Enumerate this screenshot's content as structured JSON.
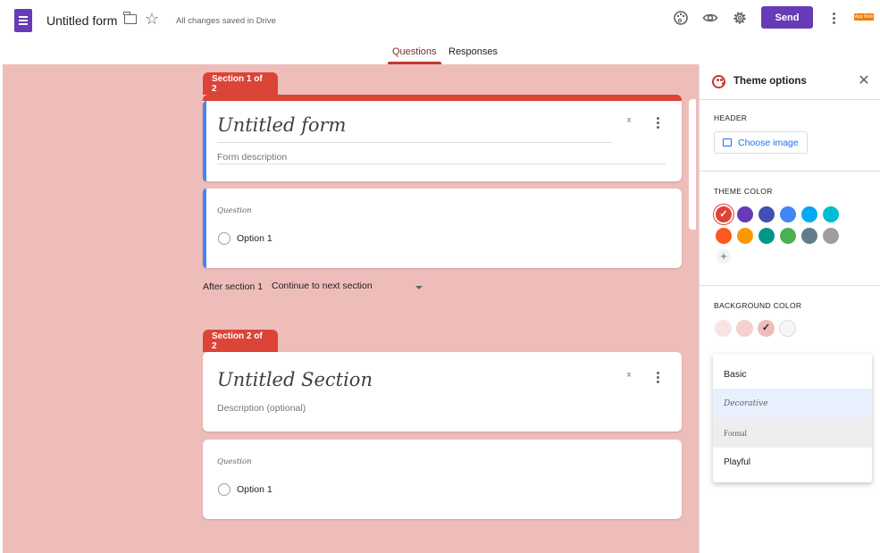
{
  "topbar": {
    "doc_title": "Untitled form",
    "save_status": "All changes saved in Drive",
    "send_label": "Send",
    "apps_badge": "App Web",
    "icons": [
      "forms-logo-icon",
      "folder-icon",
      "star-icon",
      "palette-icon",
      "eye-icon",
      "gear-icon",
      "more-vert-icon"
    ]
  },
  "tabs": [
    {
      "label": "Questions",
      "active": true
    },
    {
      "label": "Responses",
      "active": false
    }
  ],
  "sections": [
    {
      "tab_label": "Section 1 of 2",
      "title": "Untitled form",
      "description": "Form description",
      "question": {
        "label": "Question",
        "option": "Option 1"
      }
    },
    {
      "tab_label": "Section 2 of 2",
      "title": "Untitled Section",
      "description": "Description (optional)",
      "question": {
        "label": "Question",
        "option": "Option 1"
      }
    }
  ],
  "after_section": {
    "label": "After section 1",
    "value": "Continue to next section"
  },
  "theme_panel": {
    "title": "Theme options",
    "header_heading": "HEADER",
    "choose_image_label": "Choose image",
    "theme_color_heading": "THEME COLOR",
    "theme_colors": [
      "#db4437",
      "#673ab7",
      "#3f51b5",
      "#4285f4",
      "#03a9f4",
      "#00bcd4",
      "#ff5722",
      "#ff9800",
      "#009688",
      "#4caf50",
      "#607d8b",
      "#9e9e9e"
    ],
    "theme_color_selected": "#db4437",
    "background_color_heading": "BACKGROUND COLOR",
    "background_colors": [
      "#fae3e3",
      "#f6cfcf",
      "#efbdb9",
      "#f6f6f6"
    ],
    "background_color_selected": "#efbdb9",
    "font_options": [
      "Basic",
      "Decorative",
      "Formal",
      "Playful"
    ],
    "font_hovered": "Decorative",
    "font_selected": "Formal"
  },
  "colors": {
    "accent_purple": "#673ab7",
    "section_red": "#db4437",
    "canvas_bg": "#efbdb9",
    "question_accent": "#4285f4"
  }
}
